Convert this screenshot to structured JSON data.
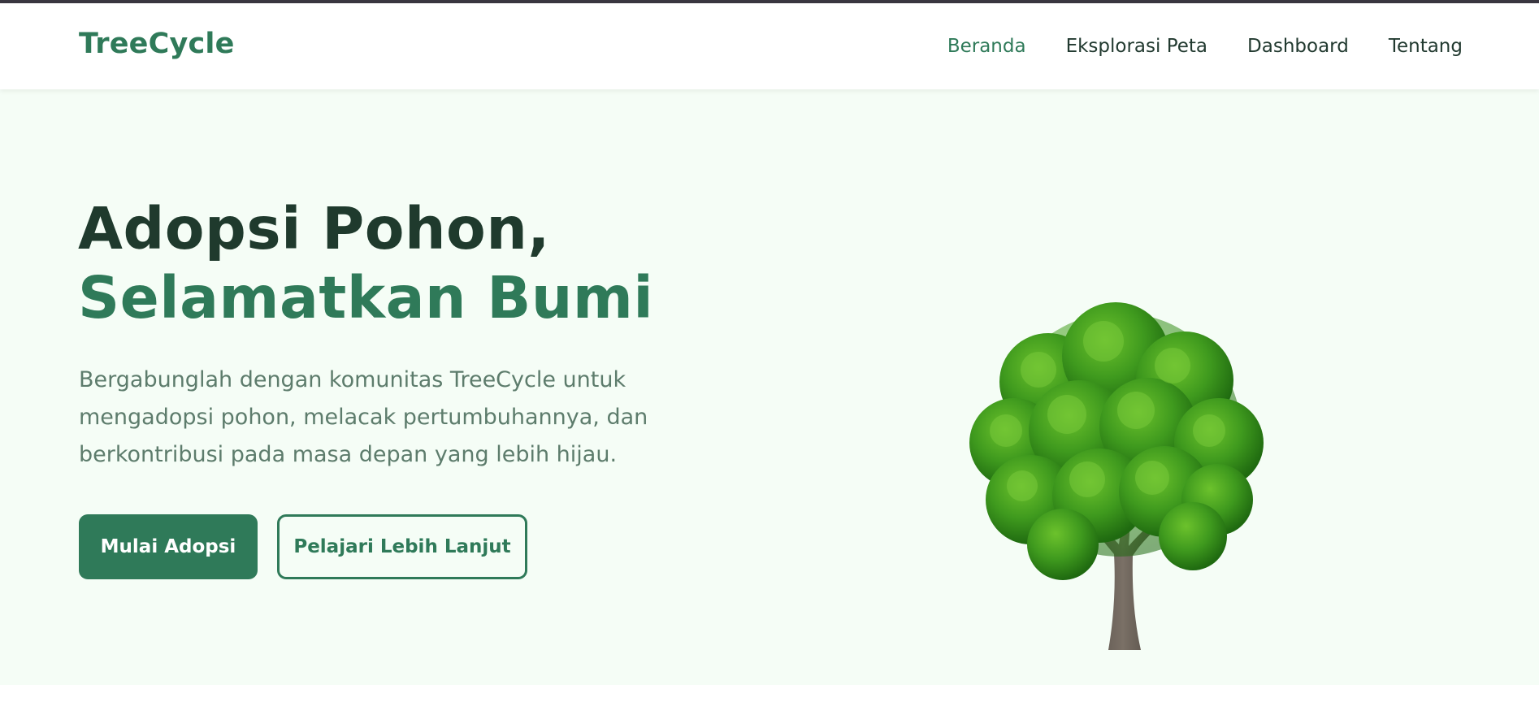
{
  "brand": {
    "name": "TreeCycle"
  },
  "nav": {
    "items": [
      {
        "label": "Beranda",
        "active": true
      },
      {
        "label": "Eksplorasi Peta",
        "active": false
      },
      {
        "label": "Dashboard",
        "active": false
      },
      {
        "label": "Tentang",
        "active": false
      }
    ]
  },
  "hero": {
    "title_line1": "Adopsi Pohon,",
    "title_line2": "Selamatkan Bumi",
    "description": "Bergabunglah dengan komunitas TreeCycle untuk mengadopsi pohon, melacak pertumbuhannya, dan berkontribusi pada masa depan yang lebih hijau.",
    "primary_button": "Mulai Adopsi",
    "secondary_button": "Pelajari Lebih Lanjut",
    "image": "tree-illustration"
  },
  "colors": {
    "brand": "#2f7a59",
    "title_dark": "#1f3a2d",
    "text_muted": "#5d7c6c",
    "hero_bg": "#f5fdf6",
    "foliage": "#3f9a1e",
    "trunk": "#6d645a"
  }
}
